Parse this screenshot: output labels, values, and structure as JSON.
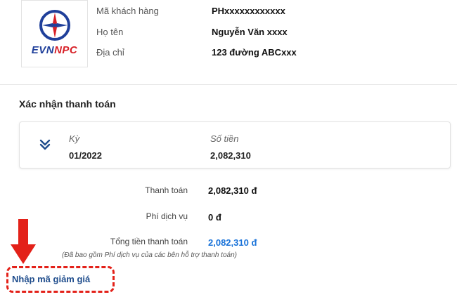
{
  "customer": {
    "logo_text_evn": "EVN",
    "logo_text_npc": "NPC",
    "rows": [
      {
        "label": "Mã khách hàng",
        "value": "PHxxxxxxxxxxxx"
      },
      {
        "label": "Họ tên",
        "value": "Nguyễn Văn xxxx"
      },
      {
        "label": "Địa chỉ",
        "value": "123 đường ABCxxx"
      }
    ]
  },
  "payment": {
    "section_title": "Xác nhận thanh toán",
    "period_header": "Kỳ",
    "amount_header": "Số tiền",
    "period_value": "01/2022",
    "amount_value": "2,082,310",
    "summary": {
      "payment_label": "Thanh toán",
      "payment_value": "2,082,310 đ",
      "fee_label": "Phí dịch vụ",
      "fee_value": "0 đ",
      "total_label": "Tổng tiền thanh toán",
      "total_value": "2,082,310 đ",
      "note": "(Đã bao gồm Phí dịch vụ của các bên hỗ trợ thanh toán)"
    },
    "discount_link": "Nhập mã giảm giá"
  },
  "colors": {
    "brand_blue": "#1f3f9a",
    "brand_red": "#d72027",
    "total_blue": "#1a73d9",
    "link_blue": "#1e4c8c",
    "annotation_red": "#e32119"
  },
  "icons": {
    "expand": "chevron-double-down-icon",
    "logo": "evnnpc-logo-icon",
    "annotation": "arrow-down-icon"
  }
}
